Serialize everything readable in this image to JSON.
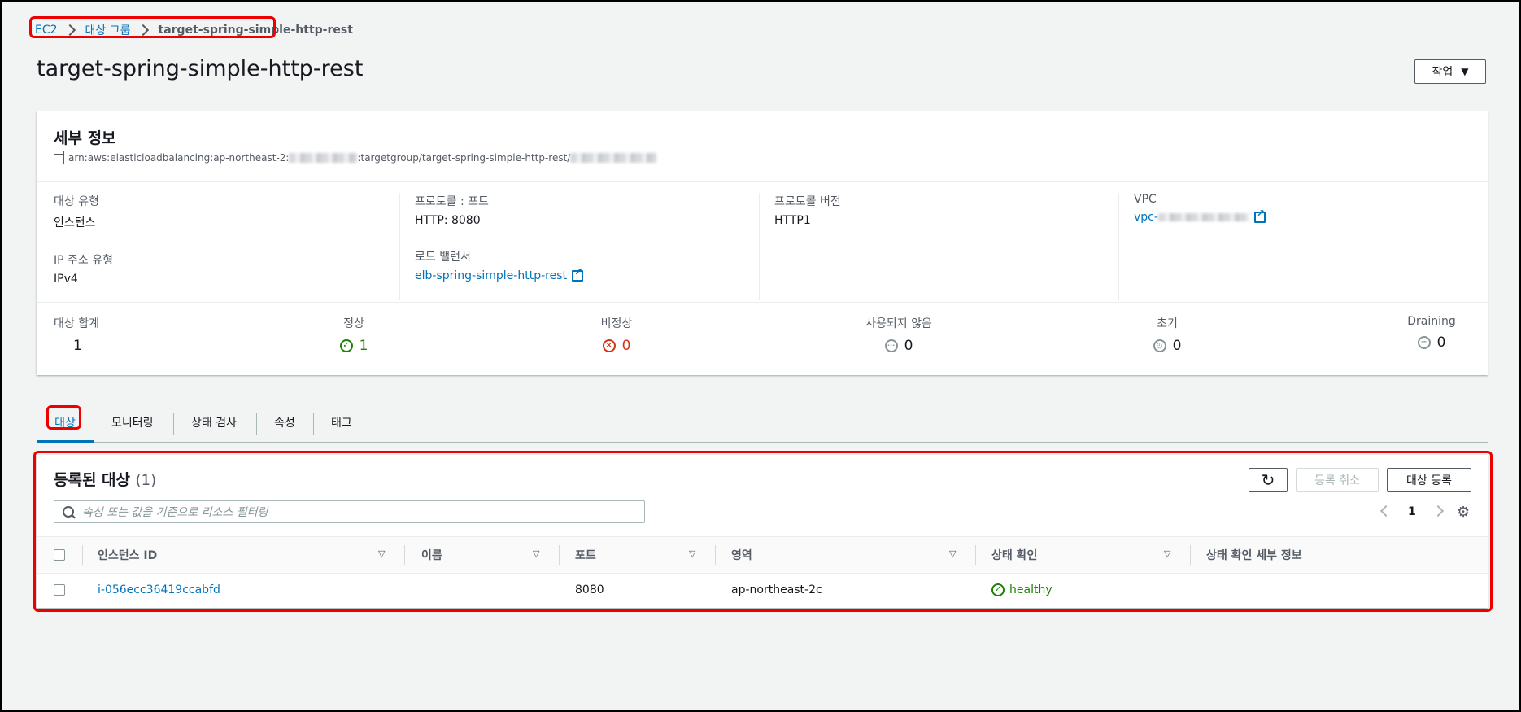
{
  "breadcrumb": {
    "items": [
      "EC2",
      "대상 그룹"
    ],
    "current": "target-spring-simple-http-rest"
  },
  "page": {
    "title": "target-spring-simple-http-rest",
    "action_label": "작업"
  },
  "details": {
    "title": "세부 정보",
    "arn_prefix": "arn:aws:elasticloadbalancing:ap-northeast-2:",
    "arn_middle": ":targetgroup/target-spring-simple-http-rest/",
    "target_type_label": "대상 유형",
    "target_type_value": "인스턴스",
    "ip_type_label": "IP 주소 유형",
    "ip_type_value": "IPv4",
    "protocol_port_label": "프로토콜 : 포트",
    "protocol_port_value": "HTTP: 8080",
    "lb_label": "로드 밸런서",
    "lb_value": "elb-spring-simple-http-rest",
    "protocol_version_label": "프로토콜 버전",
    "protocol_version_value": "HTTP1",
    "vpc_label": "VPC",
    "vpc_value": "vpc-"
  },
  "stats": {
    "total_label": "대상 합계",
    "total_value": "1",
    "healthy_label": "정상",
    "healthy_value": "1",
    "unhealthy_label": "비정상",
    "unhealthy_value": "0",
    "unused_label": "사용되지 않음",
    "unused_value": "0",
    "initial_label": "초기",
    "initial_value": "0",
    "draining_label": "Draining",
    "draining_value": "0"
  },
  "tabs": [
    "대상",
    "모니터링",
    "상태 검사",
    "속성",
    "태그"
  ],
  "targets": {
    "title": "등록된 대상",
    "count": "(1)",
    "deregister_label": "등록 취소",
    "register_label": "대상 등록",
    "search_placeholder": "속성 또는 값을 기준으로 리소스 필터링",
    "page": "1",
    "columns": [
      "인스턴스 ID",
      "이름",
      "포트",
      "영역",
      "상태 확인",
      "상태 확인 세부 정보"
    ],
    "rows": [
      {
        "instance_id": "i-056ecc36419ccabfd",
        "name": "",
        "port": "8080",
        "zone": "ap-northeast-2c",
        "health": "healthy",
        "health_detail": ""
      }
    ]
  },
  "colors": {
    "link": "#0073bb",
    "healthy": "#1d8102",
    "unhealthy": "#d13212",
    "highlight": "#e00000"
  }
}
